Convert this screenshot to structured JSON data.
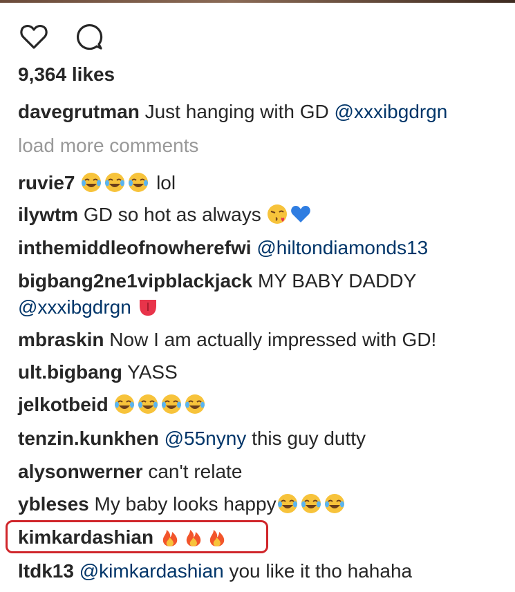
{
  "likes_text": "9,364 likes",
  "caption": {
    "user": "davegrutman",
    "text": "Just hanging with GD",
    "mention": "@xxxibgdrgn"
  },
  "load_more": "load more comments",
  "comments": [
    {
      "user": "ruvie7",
      "suffix": "lol"
    },
    {
      "user": "ilywtm",
      "text": "GD so hot as always"
    },
    {
      "user": "inthemiddleofnowherefwi",
      "mention": "@hiltondiamonds13"
    },
    {
      "user": "bigbang2ne1vipblackjack",
      "text": "MY BABY DADDY",
      "mention": "@xxxibgdrgn"
    },
    {
      "user": "mbraskin",
      "text": "Now I am actually impressed with GD!"
    },
    {
      "user": "ult.bigbang",
      "text": "YASS"
    },
    {
      "user": "jelkotbeid"
    },
    {
      "user": "tenzin.kunkhen",
      "mention": "@55nyny",
      "text": "this guy dutty"
    },
    {
      "user": "alysonwerner",
      "text": "can't relate"
    },
    {
      "user": "ybleses",
      "text": "My baby looks happy"
    },
    {
      "user": "kimkardashian"
    },
    {
      "user": "ltdk13",
      "mention": "@kimkardashian",
      "text": "you like it tho hahaha"
    }
  ],
  "icons": {
    "like": "heart-icon",
    "comment": "comment-icon",
    "laugh": "tears-of-joy-emoji",
    "kiss": "blowing-kiss-emoji",
    "heart": "blue-heart-emoji",
    "tongue": "tongue-emoji",
    "fire": "fire-emoji"
  },
  "colors": {
    "text": "#262626",
    "mention": "#003569",
    "muted": "#999999",
    "highlight": "#d0262b"
  }
}
